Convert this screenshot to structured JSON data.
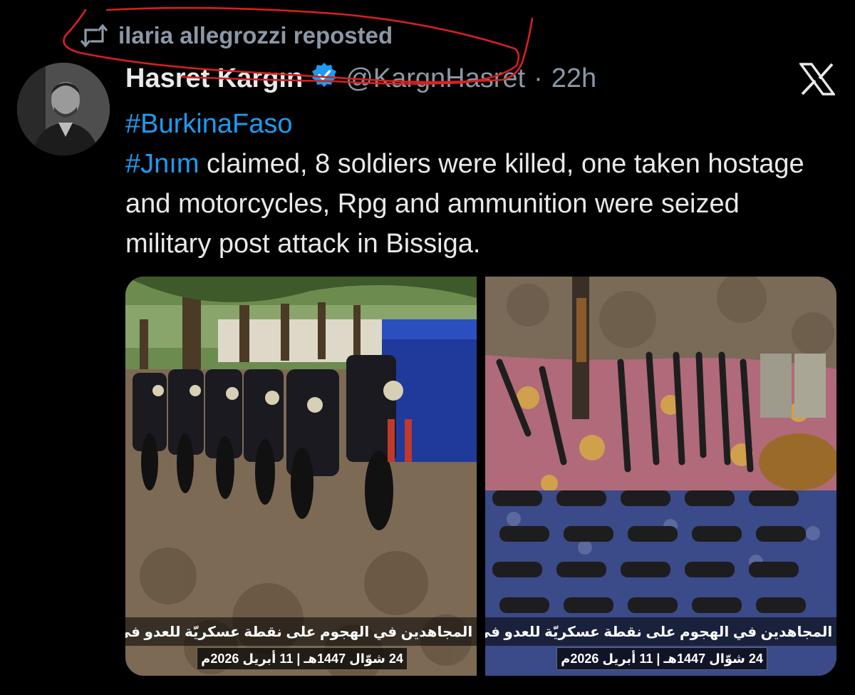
{
  "repost": {
    "icon": "repost-icon",
    "text": "ilaria allegrozzi reposted"
  },
  "author": {
    "display_name": "Hasret Kargın",
    "verified_icon": "verified-badge-icon",
    "handle": "@KargnHasret",
    "separator": "·",
    "time": "22h"
  },
  "platform_logo": "x-logo-icon",
  "tweet": {
    "hashtag_line": "#BurkinaFaso",
    "hashtag_inline": "#Jnım",
    "body_rest": " claimed, 8 soldiers were killed, one taken hostage and motorcycles, Rpg and ammunition were seized military post attack in Bissiga."
  },
  "media": [
    {
      "subject": "motorcycles",
      "caption": "غنائم المجاهدين في الهجوم على نقطة عسكريّة للعدو في (بي",
      "date": "24 شوّال 1447هـ | 11 أبريل 2026م"
    },
    {
      "subject": "weapons-and-magazines",
      "caption": "غنائم المجاهدين في الهجوم على نقطة عسكريّة للعدو في (بي",
      "date": "24 شوّال 1447هـ | 11 أبريل 2026م"
    }
  ],
  "colors": {
    "background": "#000000",
    "text": "#e7e9ea",
    "secondary": "#8b98a5",
    "link": "#1d9bf0",
    "annotation": "#d62020"
  }
}
